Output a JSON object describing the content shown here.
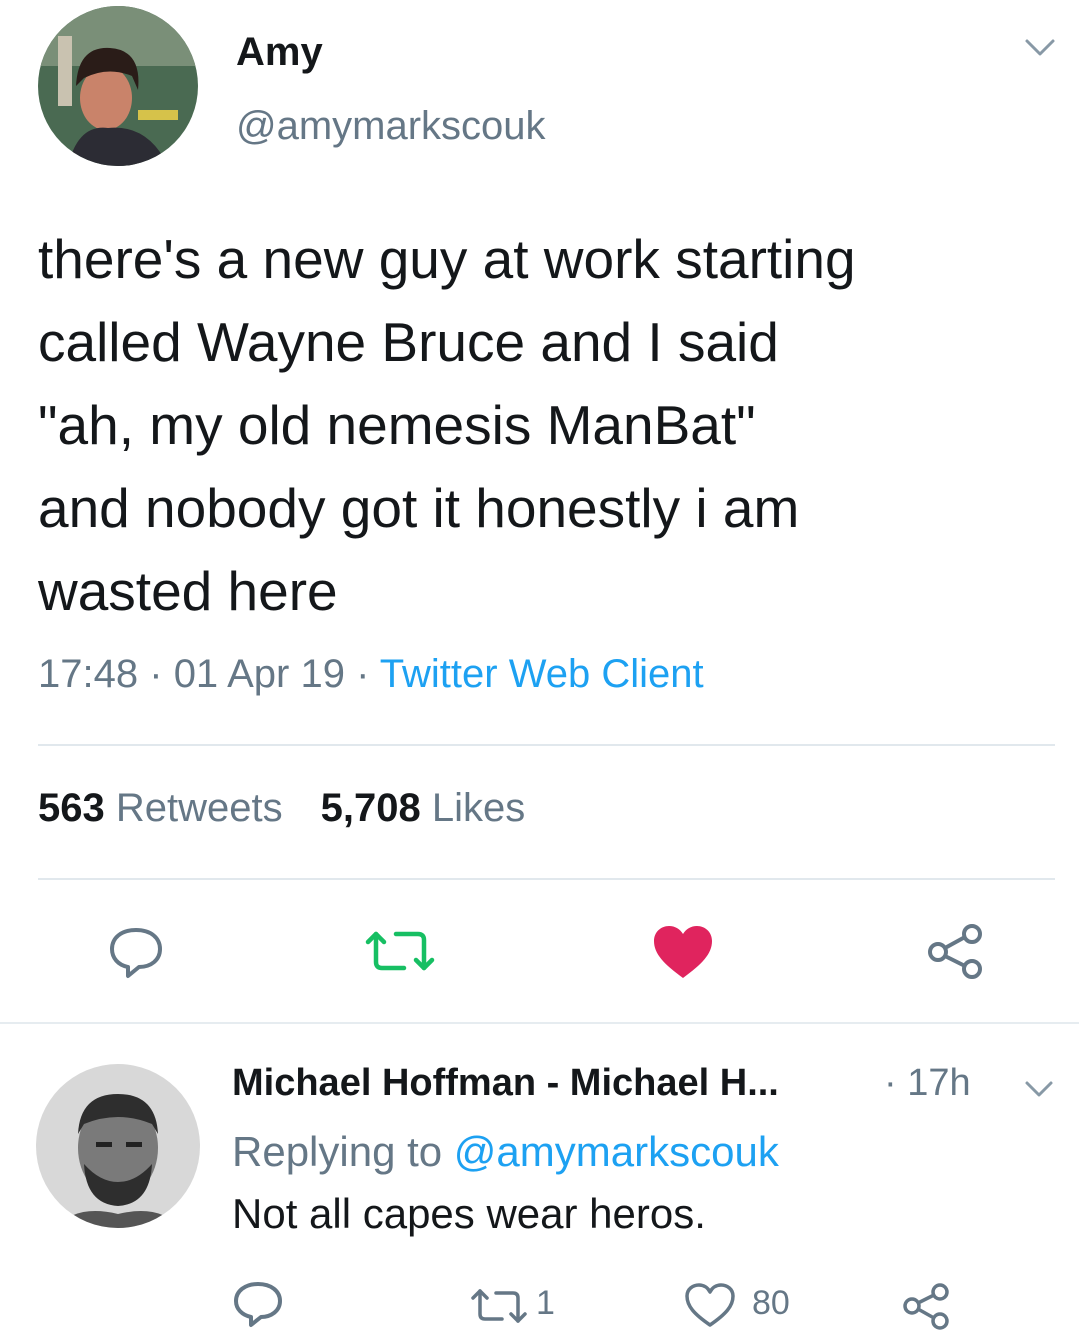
{
  "tweet": {
    "author_name": "Amy",
    "author_handle": "@amymarkscouk",
    "text_lines": [
      "there's a new guy at work starting",
      "called Wayne Bruce and I said",
      "\"ah, my old nemesis ManBat\"",
      "and nobody got it honestly i am",
      "wasted here"
    ],
    "time": "17:48",
    "date": "01 Apr 19",
    "separator": "·",
    "client": "Twitter Web Client",
    "retweets_count": "563",
    "retweets_label": "Retweets",
    "likes_count": "5,708",
    "likes_label": "Likes",
    "liked": true
  },
  "reply": {
    "author_name": "Michael Hoffman - Michael H...",
    "time": "· 17h",
    "replying_prefix": "Replying to",
    "replying_to": "@amymarkscouk",
    "text": "Not all capes wear heros.",
    "retweet_count": "1",
    "like_count": "80"
  },
  "colors": {
    "accent_blue": "#1da1f2",
    "retweet_green": "#17bf63",
    "like_red": "#e0245e",
    "muted_gray": "#657786",
    "icon_gray": "#657786",
    "divider": "#e1e8ed"
  },
  "icons": {
    "tweet_menu": "chevron-down-icon",
    "reply": "reply-icon",
    "retweet": "retweet-icon",
    "like": "heart-icon",
    "share": "share-icon"
  }
}
